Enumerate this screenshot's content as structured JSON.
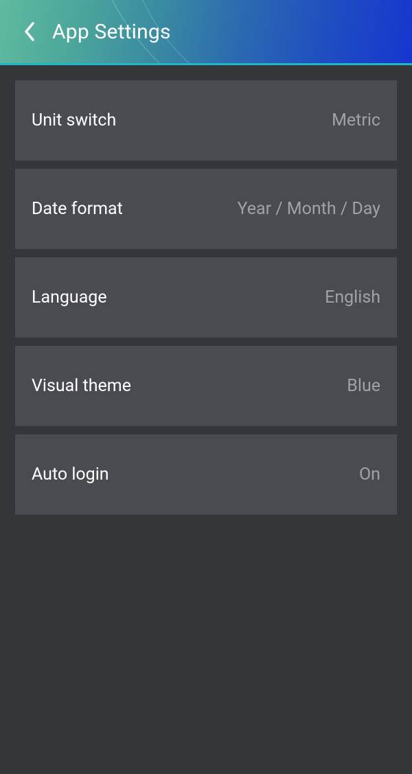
{
  "header": {
    "title": "App Settings"
  },
  "settings": {
    "items": [
      {
        "label": "Unit switch",
        "value": "Metric"
      },
      {
        "label": "Date format",
        "value": "Year / Month / Day"
      },
      {
        "label": "Language",
        "value": "English"
      },
      {
        "label": "Visual theme",
        "value": "Blue"
      },
      {
        "label": "Auto login",
        "value": "On"
      }
    ]
  }
}
